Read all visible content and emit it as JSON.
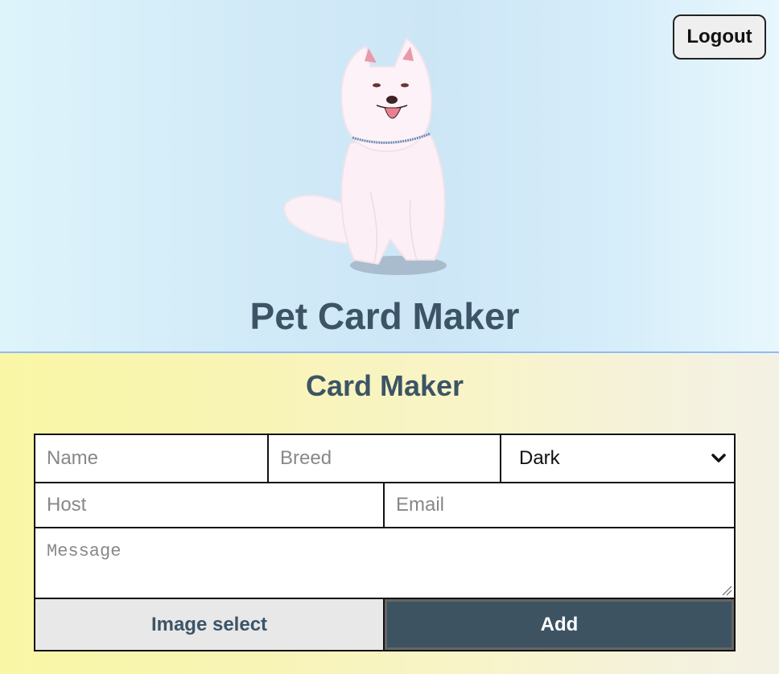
{
  "header": {
    "logout_label": "Logout",
    "app_title": "Pet Card Maker",
    "logo": "samoyed-dog-illustration"
  },
  "maker": {
    "title": "Card Maker",
    "fields": {
      "name_placeholder": "Name",
      "breed_placeholder": "Breed",
      "theme_selected": "Dark",
      "host_placeholder": "Host",
      "email_placeholder": "Email",
      "message_placeholder": "Message"
    },
    "buttons": {
      "image_select_label": "Image select",
      "add_label": "Add"
    }
  },
  "colors": {
    "title_text": "#3d5466",
    "add_button_bg": "#3d5361",
    "header_border": "#8fbcf2"
  }
}
